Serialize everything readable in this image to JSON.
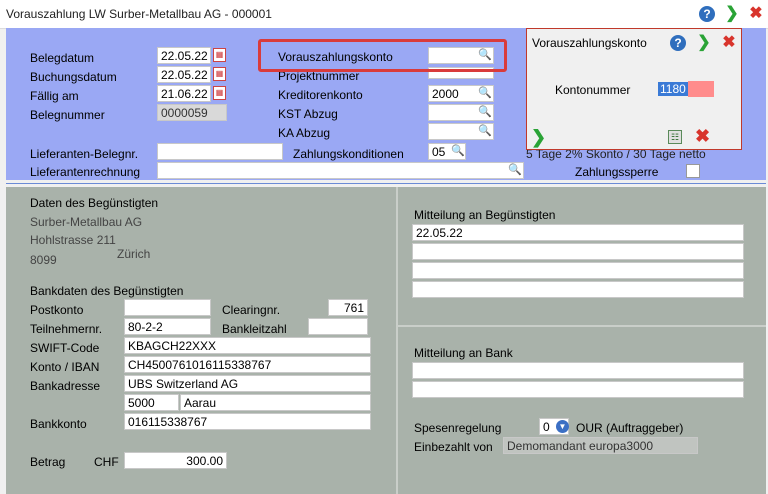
{
  "window": {
    "title": "Vorauszahlung LW Surber-Metallbau AG - 000001",
    "help_label": "?"
  },
  "form": {
    "belegdatum_label": "Belegdatum",
    "belegdatum": "22.05.22",
    "buchungsdatum_label": "Buchungsdatum",
    "buchungsdatum": "22.05.22",
    "faellig_label": "Fällig am",
    "faellig": "21.06.22",
    "belegnummer_label": "Belegnummer",
    "belegnummer": "0000059",
    "vorauszahlungskonto_label": "Vorauszahlungskonto",
    "vorauszahlungskonto": "",
    "projektnummer_label": "Projektnummer",
    "kreditorenkonto_label": "Kreditorenkonto",
    "kreditorenkonto": "2000",
    "kst_label": "KST Abzug",
    "ka_label": "KA Abzug",
    "lief_belegnr_label": "Lieferanten-Belegnr.",
    "lief_belegnr": "",
    "zahlungskonditionen_label": "Zahlungskonditionen",
    "zahlungskonditionen": "05",
    "konditionen_text": "5 Tage 2% Skonto / 30 Tage netto",
    "lief_rechnung_label": "Lieferantenrechnung",
    "lief_rechnung": "",
    "zahlungssperre_label": "Zahlungssperre"
  },
  "beguenstigter": {
    "section_title": "Daten des Begünstigten",
    "name": "Surber-Metallbau AG",
    "strasse": "Hohlstrasse 211",
    "plz": "8099",
    "ort": "Zürich"
  },
  "bank": {
    "section_title": "Bankdaten des Begünstigten",
    "postkonto_label": "Postkonto",
    "postkonto": "",
    "clearing_label": "Clearingnr.",
    "clearing": "761",
    "teilnehmer_label": "Teilnehmernr.",
    "teilnehmer": "80-2-2",
    "bankleitzahl_label": "Bankleitzahl",
    "bankleitzahl": "",
    "swift_label": "SWIFT-Code",
    "swift": "KBAGCH22XXX",
    "iban_label": "Konto / IBAN",
    "iban": "CH4500761016115338767",
    "bankadresse_label": "Bankadresse",
    "bankadresse": "UBS Switzerland AG",
    "bank_plz": "5000",
    "bank_ort": "Aarau",
    "bankkonto_label": "Bankkonto",
    "bankkonto": "016115338767",
    "betrag_label": "Betrag",
    "currency": "CHF",
    "betrag": "300.00"
  },
  "mitteilung": {
    "beguenstigter_title": "Mitteilung an Begünstigten",
    "beguenstigter_line1": "22.05.22",
    "bank_title": "Mitteilung an Bank",
    "spesen_label": "Spesenregelung",
    "spesen_code": "0",
    "spesen_text": "OUR (Auftraggeber)",
    "einbezahlt_label": "Einbezahlt von",
    "einbezahlt": "Demomandant europa3000"
  },
  "popup": {
    "title": "Vorauszahlungskonto",
    "kontonummer_label": "Kontonummer",
    "kontonummer": "1180"
  }
}
